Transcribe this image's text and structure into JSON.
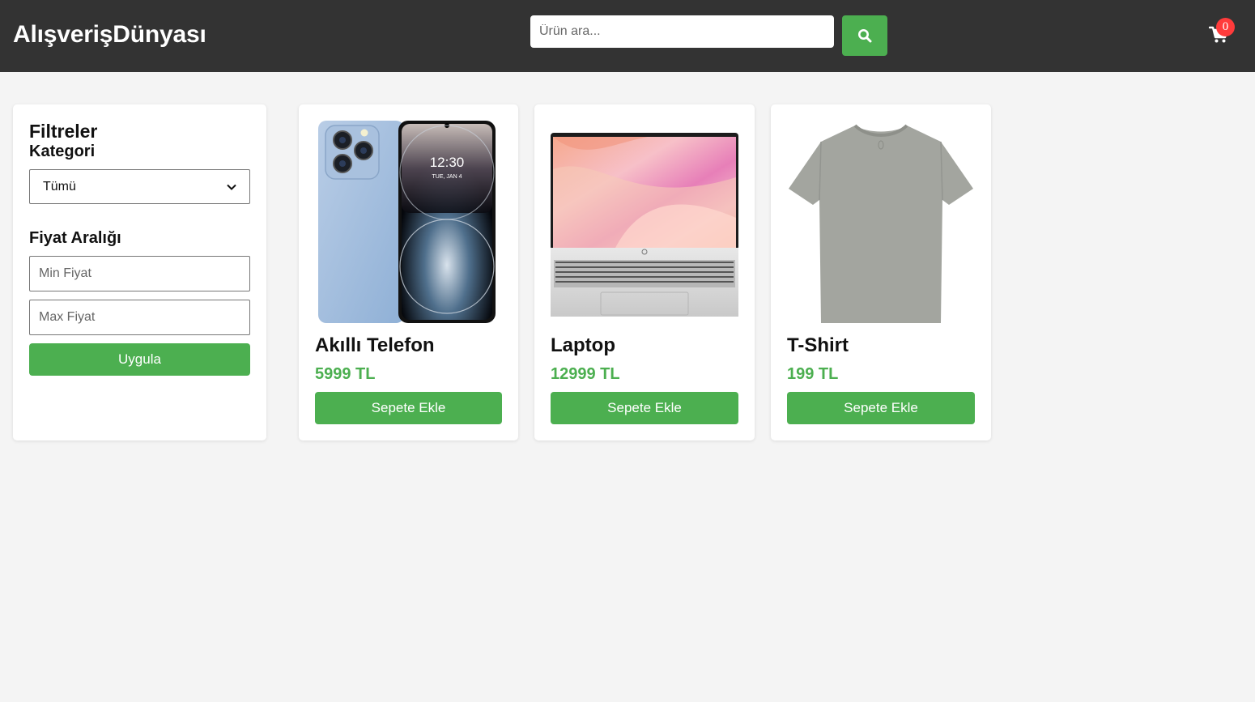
{
  "header": {
    "logo": "AlışverişDünyası",
    "search_placeholder": "Ürün ara...",
    "search_icon": "search-icon",
    "cart_icon": "shopping-cart-icon",
    "cart_count": "0"
  },
  "sidebar": {
    "title": "Filtreler",
    "category_label": "Kategori",
    "category_selected": "Tümü",
    "price_label": "Fiyat Aralığı",
    "min_placeholder": "Min Fiyat",
    "max_placeholder": "Max Fiyat",
    "apply_label": "Uygula"
  },
  "products": [
    {
      "name": "Akıllı Telefon",
      "price": "5999 TL",
      "button": "Sepete Ekle",
      "image": "phone-image",
      "clock": "12:30",
      "date": "TUE, JAN 4"
    },
    {
      "name": "Laptop",
      "price": "12999 TL",
      "button": "Sepete Ekle",
      "image": "laptop-image"
    },
    {
      "name": "T-Shirt",
      "price": "199 TL",
      "button": "Sepete Ekle",
      "image": "tshirt-image"
    }
  ],
  "colors": {
    "header_bg": "#333333",
    "accent": "#4caf50",
    "badge": "#ff3b3b",
    "page_bg": "#f4f4f4"
  }
}
